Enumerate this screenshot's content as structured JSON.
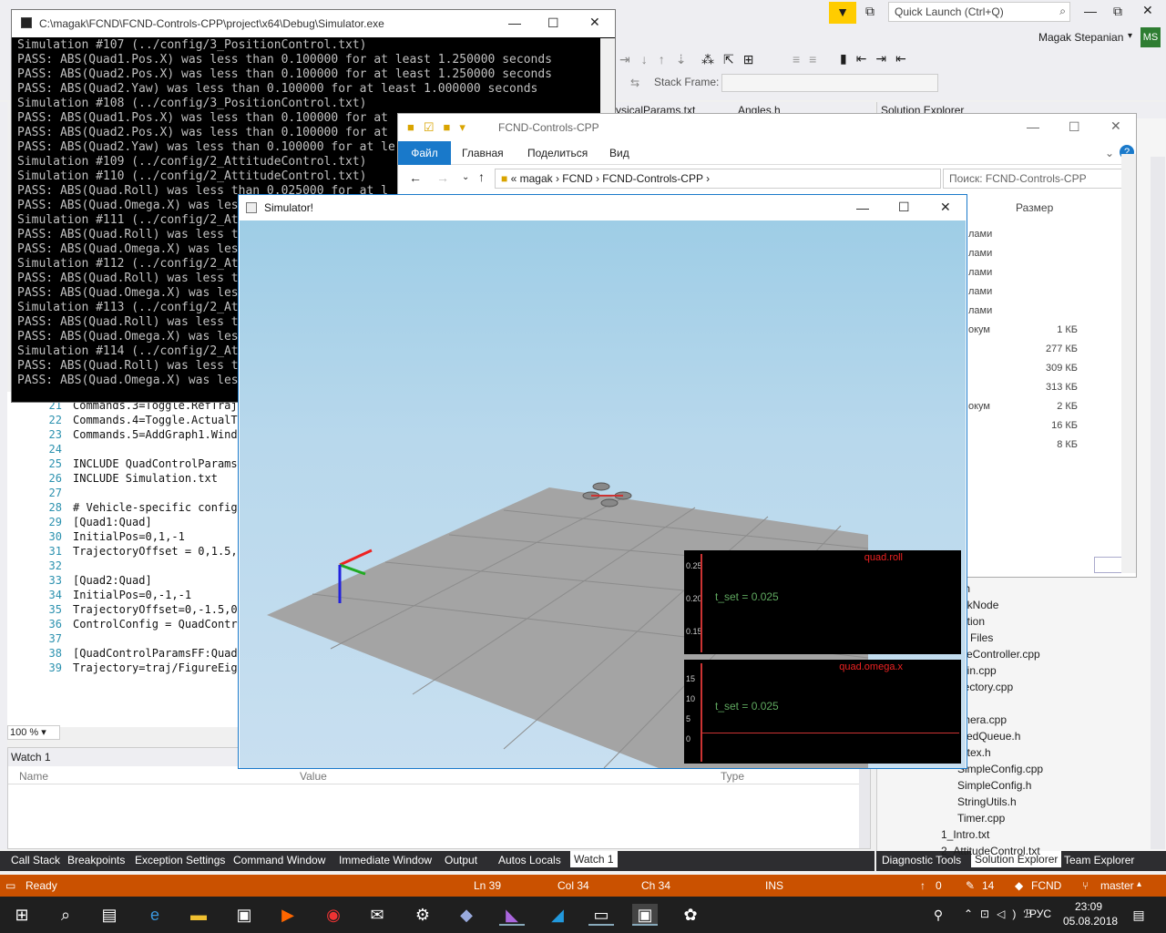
{
  "vs": {
    "quick_launch": "Quick Launch (Ctrl+Q)",
    "user": "Magak Stepanian",
    "user_initials": "MS",
    "stack_frame_label": "Stack Frame:",
    "tabs": [
      "ysicalParams.txt",
      "Angles.h"
    ],
    "solution_explorer_title": "Solution Explorer",
    "zoom": "100 %"
  },
  "editor": {
    "lines": [
      {
        "n": "21",
        "t": "Commands.3=Toggle.RefTraje"
      },
      {
        "n": "22",
        "t": "Commands.4=Toggle.ActualTr"
      },
      {
        "n": "23",
        "t": "Commands.5=AddGraph1.Windo"
      },
      {
        "n": "24",
        "t": ""
      },
      {
        "n": "25",
        "t": "INCLUDE QuadControlParams."
      },
      {
        "n": "26",
        "t": "INCLUDE Simulation.txt"
      },
      {
        "n": "27",
        "t": ""
      },
      {
        "n": "28",
        "t": "# Vehicle-specific config"
      },
      {
        "n": "29",
        "t": "[Quad1:Quad]"
      },
      {
        "n": "30",
        "t": "InitialPos=0,1,-1"
      },
      {
        "n": "31",
        "t": "TrajectoryOffset = 0,1.5,0"
      },
      {
        "n": "32",
        "t": ""
      },
      {
        "n": "33",
        "t": "[Quad2:Quad]"
      },
      {
        "n": "34",
        "t": "InitialPos=0,-1,-1"
      },
      {
        "n": "35",
        "t": "TrajectoryOffset=0,-1.5,0"
      },
      {
        "n": "36",
        "t": "ControlConfig = QuadContro"
      },
      {
        "n": "37",
        "t": ""
      },
      {
        "n": "38",
        "t": "[QuadControlParamsFF:QuadC"
      },
      {
        "n": "39",
        "t": "Trajectory=traj/FigureEigh"
      }
    ]
  },
  "watch": {
    "title": "Watch 1",
    "col_name": "Name",
    "col_value": "Value",
    "col_type": "Type"
  },
  "bottom_tabs": [
    "Call Stack",
    "Breakpoints",
    "Exception Settings",
    "Command Window",
    "Immediate Window",
    "Output",
    "Autos",
    "Locals",
    "Watch 1"
  ],
  "right_tabs": [
    "Diagnostic Tools",
    "Solution Explorer",
    "Team Explorer"
  ],
  "status": {
    "ready": "Ready",
    "ln": "Ln 39",
    "col": "Col 34",
    "ch": "Ch 34",
    "ins": "INS",
    "up": "0",
    "edits": "14",
    "repo": "FCND",
    "branch": "master"
  },
  "taskbar": {
    "lang": "РУС",
    "time": "23:09",
    "date": "05.08.2018"
  },
  "console": {
    "title": "C:\\magak\\FCND\\FCND-Controls-CPP\\project\\x64\\Debug\\Simulator.exe",
    "lines": [
      "Simulation #107 (../config/3_PositionControl.txt)",
      "PASS: ABS(Quad1.Pos.X) was less than 0.100000 for at least 1.250000 seconds",
      "PASS: ABS(Quad2.Pos.X) was less than 0.100000 for at least 1.250000 seconds",
      "PASS: ABS(Quad2.Yaw) was less than 0.100000 for at least 1.000000 seconds",
      "Simulation #108 (../config/3_PositionControl.txt)",
      "PASS: ABS(Quad1.Pos.X) was less than 0.100000 for at",
      "PASS: ABS(Quad2.Pos.X) was less than 0.100000 for at",
      "PASS: ABS(Quad2.Yaw) was less than 0.100000 for at le",
      "Simulation #109 (../config/2_AttitudeControl.txt)",
      "Simulation #110 (../config/2_AttitudeControl.txt)",
      "PASS: ABS(Quad.Roll) was less than 0.025000 for at l",
      "PASS: ABS(Quad.Omega.X) was les",
      "Simulation #111 (../config/2_At",
      "PASS: ABS(Quad.Roll) was less t",
      "PASS: ABS(Quad.Omega.X) was les",
      "Simulation #112 (../config/2_At",
      "PASS: ABS(Quad.Roll) was less t",
      "PASS: ABS(Quad.Omega.X) was les",
      "Simulation #113 (../config/2_At",
      "PASS: ABS(Quad.Roll) was less t",
      "PASS: ABS(Quad.Omega.X) was les",
      "Simulation #114 (../config/2_At",
      "PASS: ABS(Quad.Roll) was less t",
      "PASS: ABS(Quad.Omega.X) was les"
    ]
  },
  "explorer": {
    "title": "FCND-Controls-CPP",
    "ribbon": [
      "Файл",
      "Главная",
      "Поделиться",
      "Вид"
    ],
    "path": [
      "magak",
      "FCND",
      "FCND-Controls-CPP"
    ],
    "search_placeholder": "Поиск: FCND-Controls-CPP",
    "size_header": "Размер",
    "rows": [
      {
        "type": "лами",
        "size": ""
      },
      {
        "type": "лами",
        "size": ""
      },
      {
        "type": "лами",
        "size": ""
      },
      {
        "type": "лами",
        "size": ""
      },
      {
        "type": "лами",
        "size": ""
      },
      {
        "type": "окум",
        "size": "1 КБ"
      },
      {
        "type": "",
        "size": "277 КБ"
      },
      {
        "type": "",
        "size": "309 КБ"
      },
      {
        "type": "",
        "size": "313 КБ"
      },
      {
        "type": "окум",
        "size": "2 КБ"
      },
      {
        "type": "",
        "size": "16 КБ"
      },
      {
        "type": "",
        "size": "8 КБ"
      }
    ]
  },
  "solution_tree": [
    ".h",
    "nkNode",
    "ation",
    "e Files",
    "seController.cpp",
    "ain.cpp",
    "jectory.cpp",
    "",
    "mera.cpp",
    "xedQueue.h",
    "utex.h",
    "SimpleConfig.cpp",
    "SimpleConfig.h",
    "StringUtils.h",
    "Timer.cpp",
    "1_Intro.txt",
    "2_AttitudeControl.txt"
  ],
  "simulator": {
    "title": "Simulator!",
    "graph1": {
      "title": "quad.roll",
      "set_label": "t_set",
      "set_value": "0.025",
      "ticks": [
        "0.25",
        "0.20",
        "0.15"
      ]
    },
    "graph2": {
      "title": "quad.omega.x",
      "set_label": "t_set",
      "set_value": "0.025",
      "ticks": [
        "15",
        "10",
        "5",
        "0"
      ]
    }
  }
}
